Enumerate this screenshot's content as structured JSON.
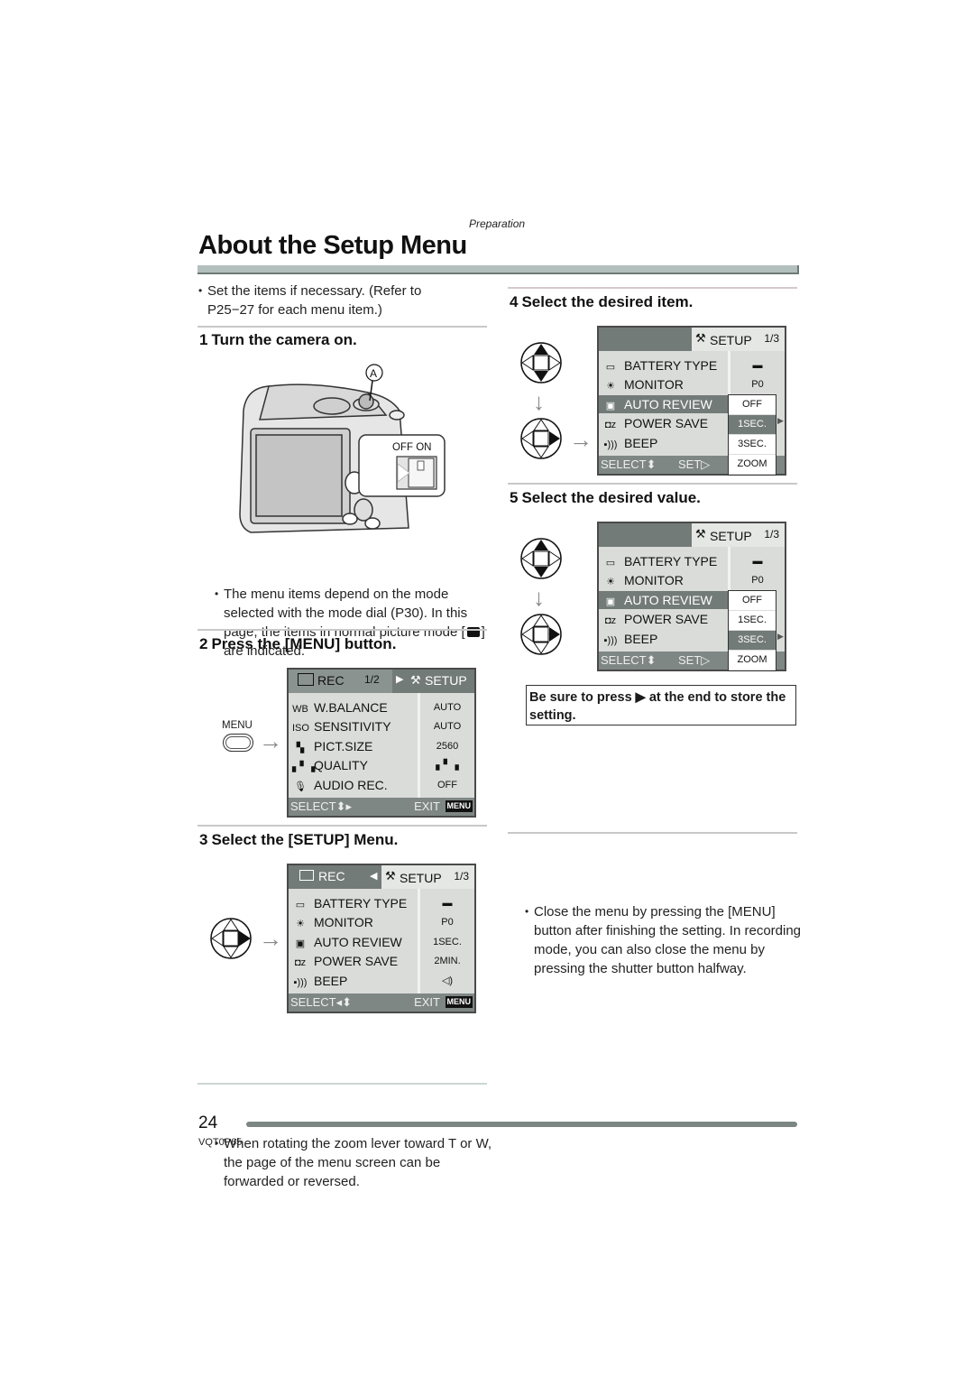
{
  "header": {
    "section": "Preparation",
    "title": "About the Setup Menu"
  },
  "intro": {
    "bullet": "Set the items if necessary. (Refer to P25−27 for each menu item.)"
  },
  "step1": {
    "num": "1",
    "heading": "Turn the camera on.",
    "callout_label": "A",
    "switch_label": "OFF ON",
    "note": "The menu items depend on the mode selected with the mode dial (P30). In this page, the items in normal picture mode [",
    "note_end": "] are indicated.",
    "icon": "camera-icon"
  },
  "step2": {
    "num": "2",
    "heading": "Press the [MENU] button.",
    "button_label": "MENU",
    "screen": {
      "tab_rec": "REC",
      "page": "1/2",
      "tab_setup": "SETUP",
      "rows": [
        {
          "icon": "WB",
          "label": "W.BALANCE",
          "value": "AUTO"
        },
        {
          "icon": "ISO",
          "label": "SENSITIVITY",
          "value": "AUTO"
        },
        {
          "icon": "▚",
          "label": "PICT.SIZE",
          "value": "2560"
        },
        {
          "icon": "▖▘▗",
          "label": "QUALITY",
          "value": "▖▘▗"
        },
        {
          "icon": "🎙",
          "label": "AUDIO REC.",
          "value": "OFF"
        }
      ],
      "footer_select": "SELECT⬍▸",
      "footer_exit": "EXIT",
      "menu_tag": "MENU"
    }
  },
  "step3": {
    "num": "3",
    "heading": "Select the [SETUP] Menu.",
    "screen": {
      "tab_rec": "REC",
      "tab_setup": "SETUP",
      "page": "1/3",
      "rows": [
        {
          "icon": "▭",
          "label": "BATTERY TYPE",
          "value": "▬"
        },
        {
          "icon": "☀",
          "label": "MONITOR",
          "value": "P0"
        },
        {
          "icon": "▣",
          "label": "AUTO REVIEW",
          "value": "1SEC."
        },
        {
          "icon": "◘z",
          "label": "POWER SAVE",
          "value": "2MIN."
        },
        {
          "icon": "▪)))",
          "label": "BEEP",
          "value": "◁)"
        }
      ],
      "footer_select": "SELECT◂⬍",
      "footer_exit": "EXIT",
      "menu_tag": "MENU"
    },
    "note": "When rotating the zoom lever      toward T or W, the page of the menu screen can be forwarded or reversed."
  },
  "step4": {
    "num": "4",
    "heading": "Select the desired item.",
    "screen": {
      "tab_setup": "SETUP",
      "page": "1/3",
      "rows": [
        {
          "icon": "▭",
          "label": "BATTERY TYPE",
          "value": "▬"
        },
        {
          "icon": "☀",
          "label": "MONITOR",
          "value": "P0"
        },
        {
          "icon": "▣",
          "label": "AUTO REVIEW",
          "value": ""
        },
        {
          "icon": "◘z",
          "label": "POWER SAVE",
          "value": ""
        },
        {
          "icon": "▪)))",
          "label": "BEEP",
          "value": ""
        }
      ],
      "options": [
        "OFF",
        "1SEC.",
        "3SEC.",
        "ZOOM"
      ],
      "selected_option": "1SEC.",
      "footer_select": "SELECT⬍",
      "footer_set": "SET▷"
    }
  },
  "step5": {
    "num": "5",
    "heading": "Select the desired value.",
    "screen": {
      "tab_setup": "SETUP",
      "page": "1/3",
      "rows": [
        {
          "icon": "▭",
          "label": "BATTERY TYPE",
          "value": "▬"
        },
        {
          "icon": "☀",
          "label": "MONITOR",
          "value": "P0"
        },
        {
          "icon": "▣",
          "label": "AUTO REVIEW",
          "value": ""
        },
        {
          "icon": "◘z",
          "label": "POWER SAVE",
          "value": ""
        },
        {
          "icon": "▪)))",
          "label": "BEEP",
          "value": ""
        }
      ],
      "options": [
        "OFF",
        "1SEC.",
        "3SEC.",
        "ZOOM"
      ],
      "selected_option": "3SEC.",
      "footer_select": "SELECT⬍",
      "footer_set": "SET▷"
    },
    "note_box": "Be sure to press ▶ at the end to store the setting.",
    "note": "Close the menu by pressing the [MENU] button after finishing the setting. In recording mode, you can also close the menu by pressing the shutter button halfway."
  },
  "footer": {
    "page_number": "24",
    "doc_code": "VQT0P65"
  }
}
